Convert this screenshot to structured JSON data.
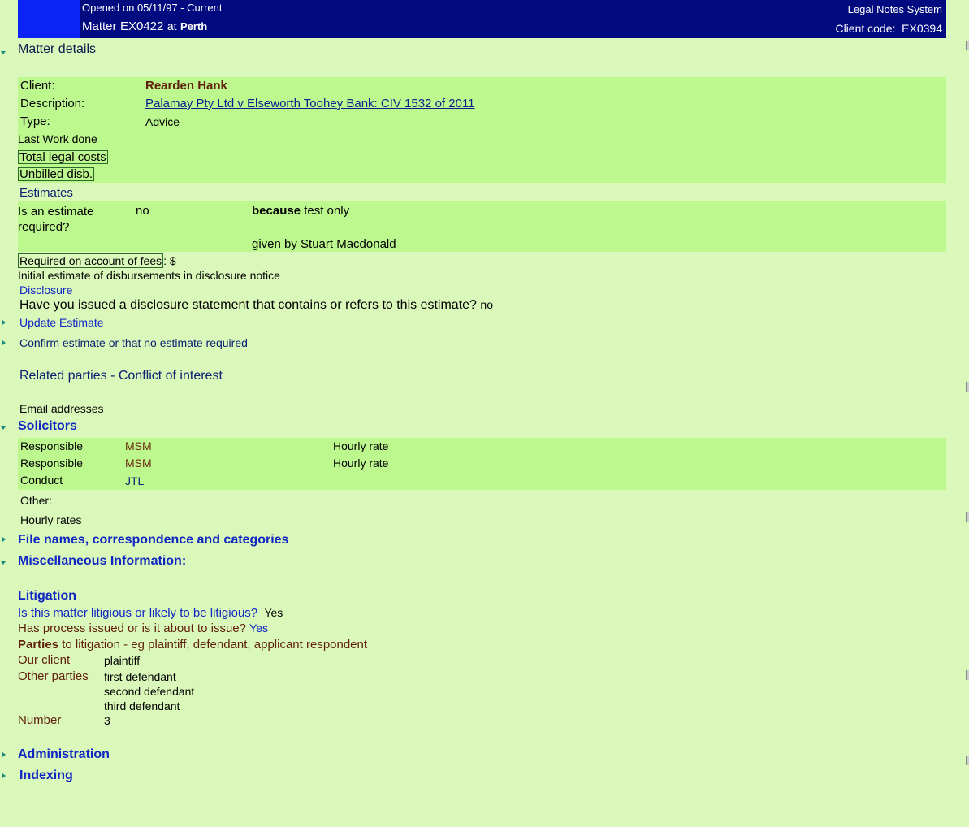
{
  "header": {
    "opened": "Opened on 05/11/97 - Current",
    "matter_prefix": "Matter",
    "matter_code": "EX0422",
    "at_word": "at",
    "location": "Perth",
    "system_name": "Legal Notes System",
    "client_code_label": "Client code:",
    "client_code": "EX0394"
  },
  "matter_details": {
    "heading": "Matter details",
    "client_label": "Client:",
    "client_value": "Rearden Hank",
    "description_label": "Description:",
    "description_value": "Palamay Pty Ltd v Elseworth Toohey Bank: CIV 1532 of 2011",
    "type_label": "Type:",
    "type_value": "Advice",
    "last_work_label": "Last Work done",
    "total_costs_label": "Total legal costs",
    "unbilled_label": "Unbilled disb."
  },
  "estimates": {
    "heading": "Estimates",
    "question": "Is an estimate required?",
    "answer": "no",
    "because_word": "because",
    "because_text": " test only",
    "given_by": "given by Stuart Macdonald",
    "required_on_account": "Required on account of fees",
    "required_suffix": ": $",
    "initial_estimate": "Initial estimate of disbursements in disclosure notice",
    "disclosure_heading": "Disclosure",
    "disclosure_question": "Have you issued a disclosure statement that contains or refers to this estimate?",
    "disclosure_answer": "no",
    "update_estimate": "Update Estimate",
    "confirm_estimate": "Confirm estimate or that no estimate required",
    "related_parties": "Related parties - Conflict of interest",
    "email_addresses": "Email addresses"
  },
  "solicitors": {
    "heading": "Solicitors",
    "rows": [
      {
        "role": "Responsible",
        "code": "MSM",
        "rate_label": "Hourly rate"
      },
      {
        "role": "Responsible",
        "code": "MSM",
        "rate_label": "Hourly rate"
      },
      {
        "role": "Conduct",
        "code": "JTL",
        "rate_label": ""
      }
    ],
    "other_label": "Other:",
    "hourly_rates_label": "Hourly rates"
  },
  "sections": {
    "files": "File names, correspondence and categories",
    "misc": "Miscellaneous Information:",
    "administration": "Administration",
    "indexing": "Indexing"
  },
  "litigation": {
    "heading": "Litigation",
    "q1": "Is this matter litigious or likely to be litigious?",
    "a1": "Yes",
    "q2": "Has process issued or is it about to issue?",
    "a2": "Yes",
    "parties_bold": "Parties",
    "parties_rest": " to litigation - eg plaintiff, defendant, applicant respondent",
    "our_client_label": "Our client",
    "our_client_value": "plaintiff",
    "other_parties_label": "Other parties",
    "other_parties": [
      "first defendant",
      "second defendant",
      "third defendant"
    ],
    "number_label": "Number",
    "number_value": "3"
  },
  "colors": {
    "page_bg": "#dbf8bb",
    "band_bg": "#bdf88e",
    "header_bg": "#020a80",
    "logo_bg": "#0a24f5",
    "section_blue": "#0f26c2"
  }
}
